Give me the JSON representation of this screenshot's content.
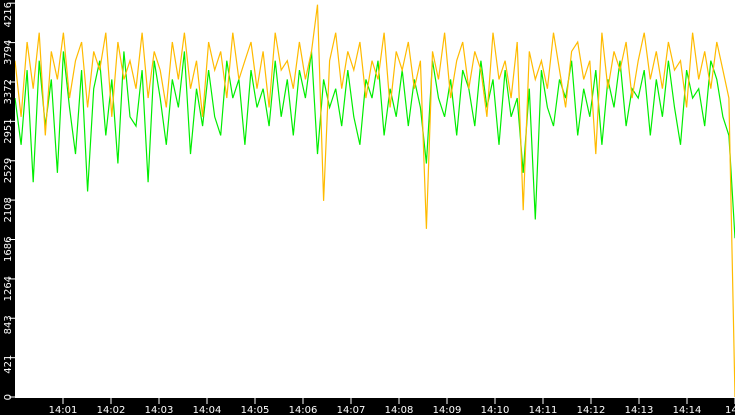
{
  "chart_data": {
    "type": "line",
    "title": "",
    "xlabel": "",
    "ylabel": "",
    "ylim": [
      0,
      4250
    ],
    "xlim_minutes": [
      0,
      15
    ],
    "grid": false,
    "y_ticks": [
      0,
      421,
      843,
      1264,
      1686,
      2108,
      2529,
      2951,
      3372,
      3794,
      4216
    ],
    "x_ticks": [
      {
        "minute": 1,
        "label": "14:01"
      },
      {
        "minute": 2,
        "label": "14:02"
      },
      {
        "minute": 3,
        "label": "14:03"
      },
      {
        "minute": 4,
        "label": "14:04"
      },
      {
        "minute": 5,
        "label": "14:05"
      },
      {
        "minute": 6,
        "label": "14:06"
      },
      {
        "minute": 7,
        "label": "14:07"
      },
      {
        "minute": 8,
        "label": "14:08"
      },
      {
        "minute": 9,
        "label": "14:09"
      },
      {
        "minute": 10,
        "label": "14:10"
      },
      {
        "minute": 11,
        "label": "14:11"
      },
      {
        "minute": 12,
        "label": "14:12"
      },
      {
        "minute": 13,
        "label": "14:13"
      },
      {
        "minute": 14,
        "label": "14:14"
      },
      {
        "minute": 15,
        "label": "14"
      }
    ],
    "series": [
      {
        "name": "green",
        "color": "#00ee00",
        "values": [
          3200,
          2700,
          3500,
          2300,
          3600,
          2900,
          3400,
          2400,
          3700,
          3100,
          2600,
          3500,
          2200,
          3300,
          3600,
          2800,
          3400,
          2500,
          3700,
          3000,
          2900,
          3500,
          2300,
          3600,
          3200,
          2700,
          3400,
          3100,
          3700,
          2600,
          3300,
          2900,
          3500,
          3000,
          2800,
          3600,
          3200,
          3400,
          2700,
          3500,
          3100,
          3300,
          2900,
          3600,
          3000,
          3400,
          2800,
          3500,
          3200,
          3700,
          2600,
          3400,
          3100,
          3300,
          2900,
          3500,
          3000,
          2700,
          3400,
          3200,
          3600,
          2800,
          3300,
          3000,
          3500,
          2900,
          3400,
          3100,
          2500,
          3600,
          3200,
          3000,
          3400,
          2800,
          3500,
          3300,
          2900,
          3600,
          3100,
          3400,
          2700,
          3500,
          3000,
          3200,
          2400,
          3300,
          1900,
          3500,
          3100,
          2900,
          3400,
          3200,
          3600,
          2800,
          3300,
          3000,
          3500,
          2700,
          3400,
          3100,
          3600,
          2900,
          3300,
          3200,
          3500,
          2800,
          3400,
          3000,
          3600,
          3100,
          2700,
          3500,
          3200,
          3300,
          2900,
          3600,
          3400,
          3000,
          2800,
          1700
        ]
      },
      {
        "name": "orange",
        "color": "#ffbb00",
        "values": [
          3600,
          3000,
          3800,
          3300,
          3900,
          2800,
          3700,
          3400,
          3900,
          3200,
          3600,
          3800,
          3100,
          3700,
          3500,
          3900,
          3000,
          3800,
          3400,
          3600,
          3300,
          3900,
          3200,
          3700,
          3500,
          3100,
          3800,
          3400,
          3900,
          3300,
          3600,
          3000,
          3800,
          3500,
          3700,
          3200,
          3900,
          3400,
          3600,
          3800,
          3300,
          3700,
          3100,
          3900,
          3500,
          3600,
          3300,
          3800,
          3400,
          3700,
          4200,
          2100,
          3600,
          3900,
          3300,
          3700,
          3500,
          3800,
          3200,
          3600,
          3400,
          3900,
          3100,
          3700,
          3500,
          3800,
          3300,
          3600,
          1800,
          3700,
          3400,
          3900,
          3200,
          3600,
          3800,
          3300,
          3700,
          3500,
          3000,
          3900,
          3400,
          3600,
          3200,
          3800,
          2000,
          3700,
          3400,
          3600,
          3300,
          3900,
          3500,
          3100,
          3700,
          3800,
          3400,
          3600,
          2600,
          3900,
          3300,
          3700,
          3500,
          3800,
          3200,
          3600,
          3900,
          3400,
          3700,
          3300,
          3800,
          3500,
          3600,
          3100,
          3900,
          3400,
          3700,
          3300,
          3800,
          3500,
          3200,
          0
        ]
      }
    ]
  }
}
